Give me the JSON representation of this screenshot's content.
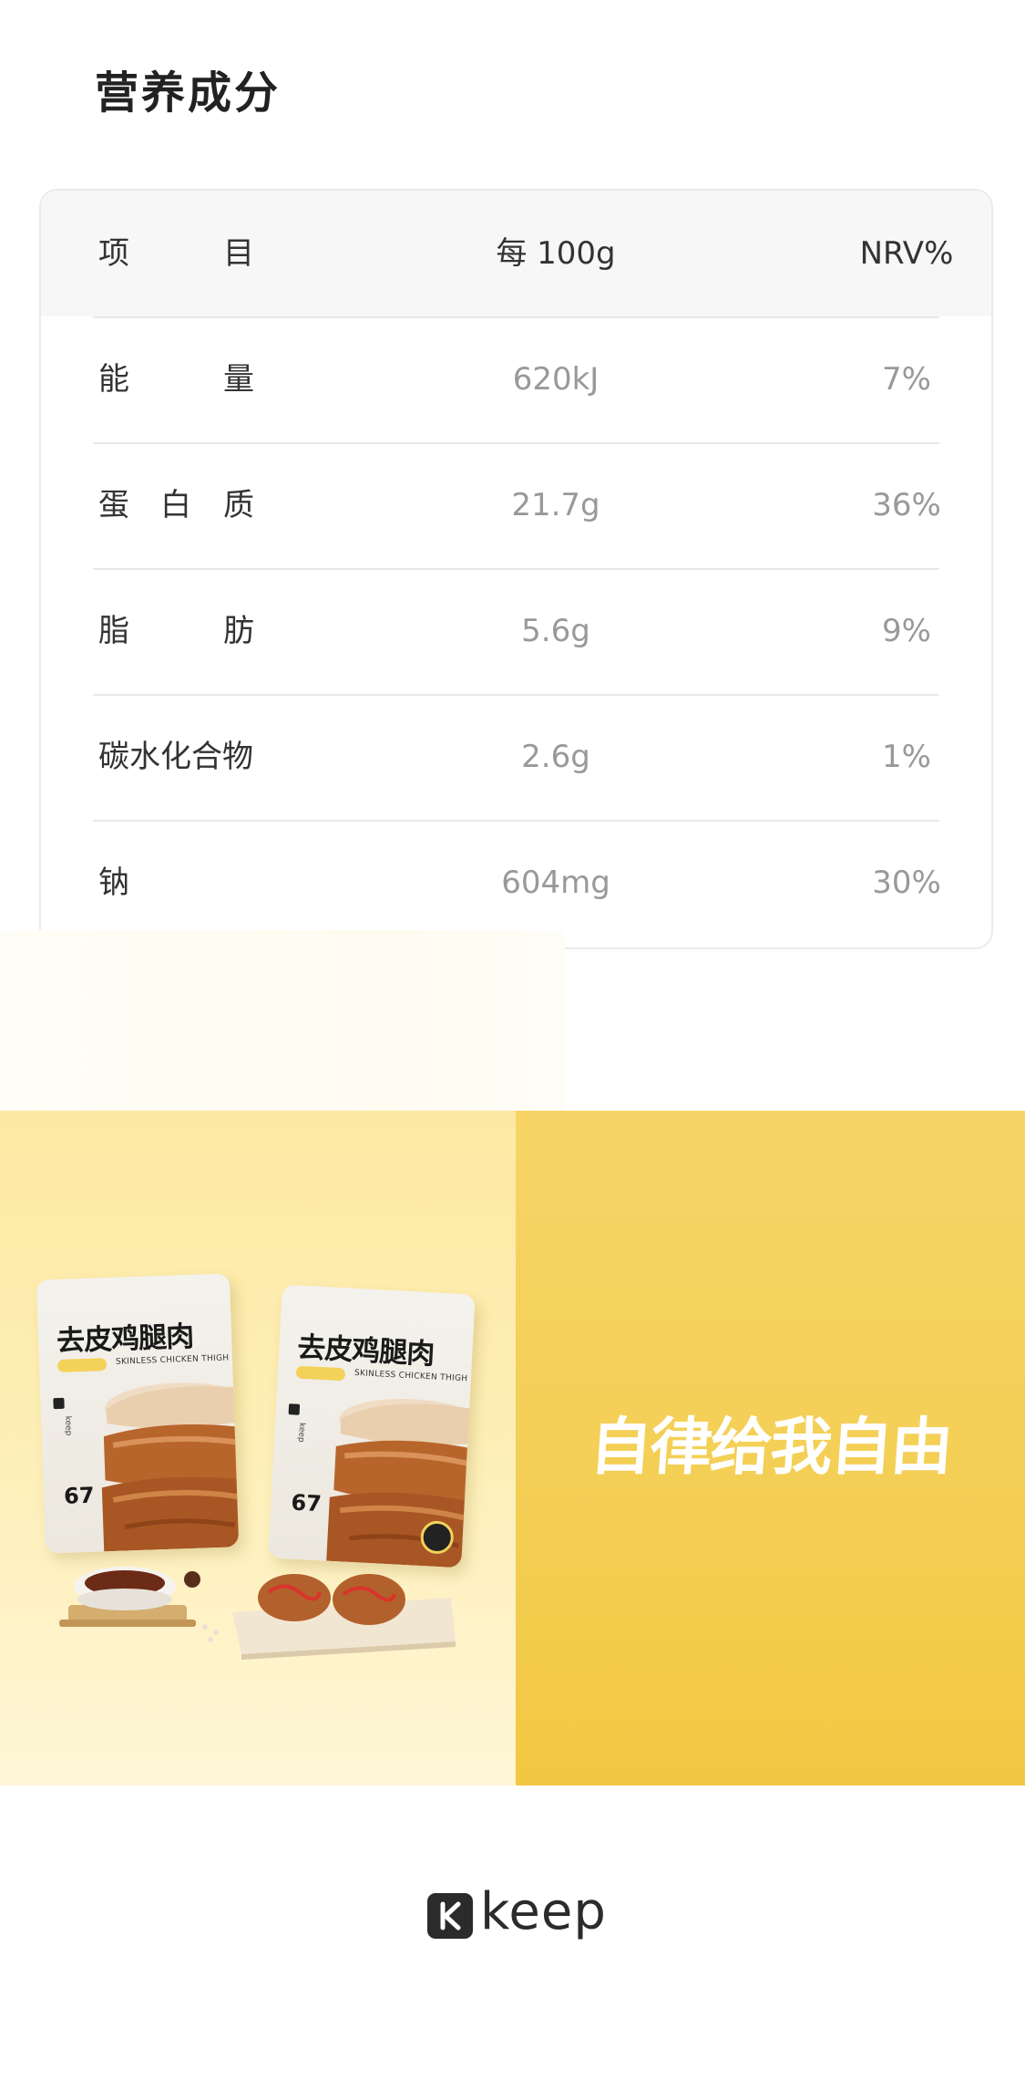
{
  "section": {
    "title": "营养成分"
  },
  "nutrition": {
    "header": {
      "item_chars": [
        "项",
        "目"
      ],
      "per": "每 100g",
      "nrv": "NRV%"
    },
    "rows": [
      {
        "name_chars": [
          "能",
          "量"
        ],
        "per": "620kJ",
        "nrv": "7%"
      },
      {
        "name_chars": [
          "蛋",
          "白",
          "质"
        ],
        "per": "21.7g",
        "nrv": "36%"
      },
      {
        "name_chars": [
          "脂",
          "肪"
        ],
        "per": "5.6g",
        "nrv": "9%"
      },
      {
        "name": "碳水化合物",
        "per": "2.6g",
        "nrv": "1%"
      },
      {
        "name": "钠",
        "per": "604mg",
        "nrv": "30%"
      }
    ]
  },
  "banner": {
    "slogan": "自律给我自由",
    "pack": {
      "title": "去皮鸡腿肉",
      "subtitle": "SKINLESS CHICKEN THIGH",
      "kcal": "67",
      "side_text": "keep"
    },
    "colors": {
      "left_bg": "#fdeeb4",
      "right_bg": "#f4cf55",
      "accent": "#f3d25a"
    }
  },
  "footer": {
    "brand": "keep",
    "icon": "keep-k-logo-icon"
  }
}
